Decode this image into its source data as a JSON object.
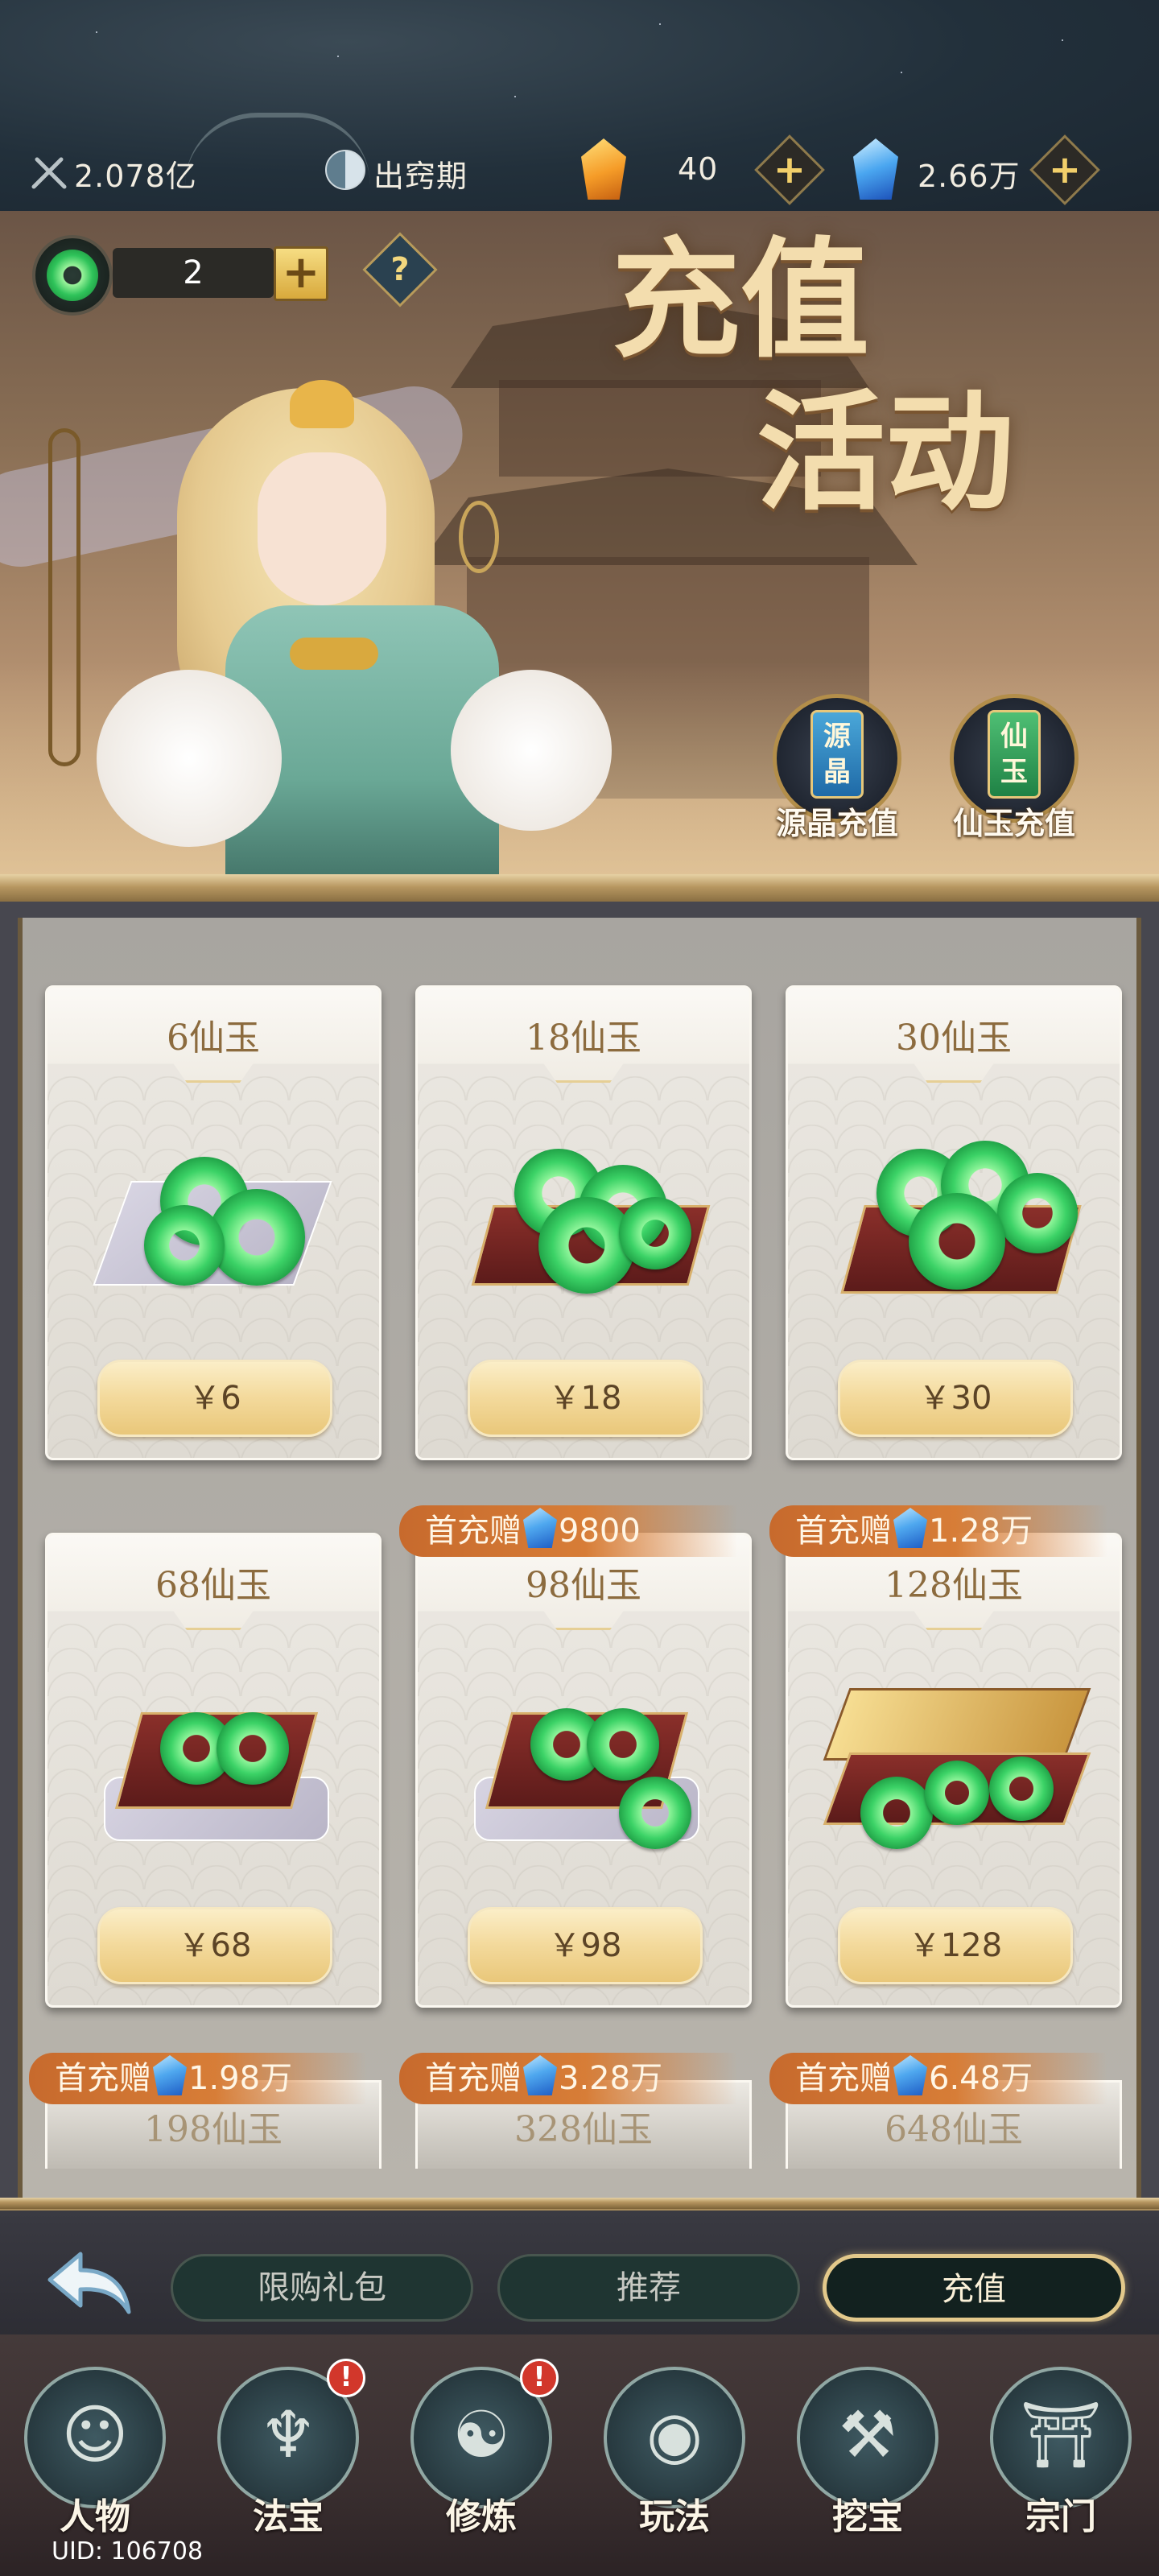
{
  "status_bar": {
    "power_value": "2.078亿",
    "realm_label": "出窍期",
    "crystal_amount": "40",
    "gem_amount": "2.66万"
  },
  "banner": {
    "ticket_count": "2",
    "help_icon_label": "?",
    "title_line1": "充值",
    "title_line2": "活动",
    "recharge_buttons": [
      {
        "tag": "源晶",
        "label": "源晶充值"
      },
      {
        "tag": "仙玉",
        "label": "仙玉充值"
      }
    ]
  },
  "products": [
    {
      "title": "6仙玉",
      "price": "￥6",
      "bonus_prefix": "",
      "bonus_value": ""
    },
    {
      "title": "18仙玉",
      "price": "￥18",
      "bonus_prefix": "",
      "bonus_value": ""
    },
    {
      "title": "30仙玉",
      "price": "￥30",
      "bonus_prefix": "",
      "bonus_value": ""
    },
    {
      "title": "68仙玉",
      "price": "￥68",
      "bonus_prefix": "",
      "bonus_value": ""
    },
    {
      "title": "98仙玉",
      "price": "￥98",
      "bonus_prefix": "首充赠",
      "bonus_value": "9800"
    },
    {
      "title": "128仙玉",
      "price": "￥128",
      "bonus_prefix": "首充赠",
      "bonus_value": "1.28万"
    },
    {
      "title": "198仙玉",
      "price": "",
      "bonus_prefix": "首充赠",
      "bonus_value": "1.98万"
    },
    {
      "title": "328仙玉",
      "price": "",
      "bonus_prefix": "首充赠",
      "bonus_value": "3.28万"
    },
    {
      "title": "648仙玉",
      "price": "",
      "bonus_prefix": "首充赠",
      "bonus_value": "6.48万"
    }
  ],
  "tabs": [
    {
      "label": "限购礼包",
      "active": false
    },
    {
      "label": "推荐",
      "active": false
    },
    {
      "label": "充值",
      "active": true
    }
  ],
  "bottom_nav": [
    {
      "label": "人物",
      "icon": "character-icon",
      "badge": ""
    },
    {
      "label": "法宝",
      "icon": "treasure-icon",
      "badge": "!"
    },
    {
      "label": "修炼",
      "icon": "cultivate-icon",
      "badge": "!"
    },
    {
      "label": "玩法",
      "icon": "gameplay-icon",
      "badge": ""
    },
    {
      "label": "挖宝",
      "icon": "shovel-icon",
      "badge": ""
    },
    {
      "label": "宗门",
      "icon": "sect-icon",
      "badge": ""
    }
  ],
  "uid_text": "UID: 106708",
  "colors": {
    "accent_gold": "#e3c98b",
    "bonus_orange": "#d77d37",
    "jade_green": "#3bd266",
    "badge_red": "#d2372b"
  }
}
